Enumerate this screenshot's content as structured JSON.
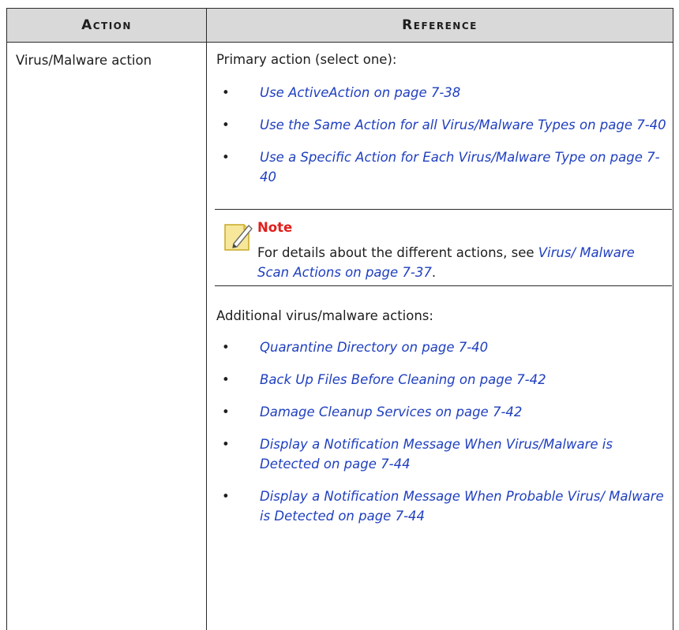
{
  "table": {
    "headers": [
      "Action",
      "Reference"
    ],
    "action": "Virus/Malware action",
    "primary_intro": "Primary action (select one):",
    "primary_links": [
      "Use ActiveAction on page 7-38",
      "Use the Same Action for all Virus/Malware Types on page 7-40",
      "Use a Specific Action for Each Virus/Malware Type on page 7-40"
    ],
    "note": {
      "icon": "pencil-note-icon",
      "title": "Note",
      "text_prefix": "For details about the different actions, see ",
      "link": "Virus/ Malware Scan Actions on page 7-37",
      "text_suffix": "."
    },
    "additional_intro": "Additional virus/malware actions:",
    "additional_links": [
      "Quarantine Directory on page 7-40",
      "Back Up Files Before Cleaning on page 7-42",
      "Damage Cleanup Services on page 7-42",
      "Display a Notification Message When Virus/Malware is Detected on page 7-44",
      "Display a Notification Message When Probable Virus/ Malware is Detected on page 7-44"
    ],
    "bullet": "•"
  }
}
